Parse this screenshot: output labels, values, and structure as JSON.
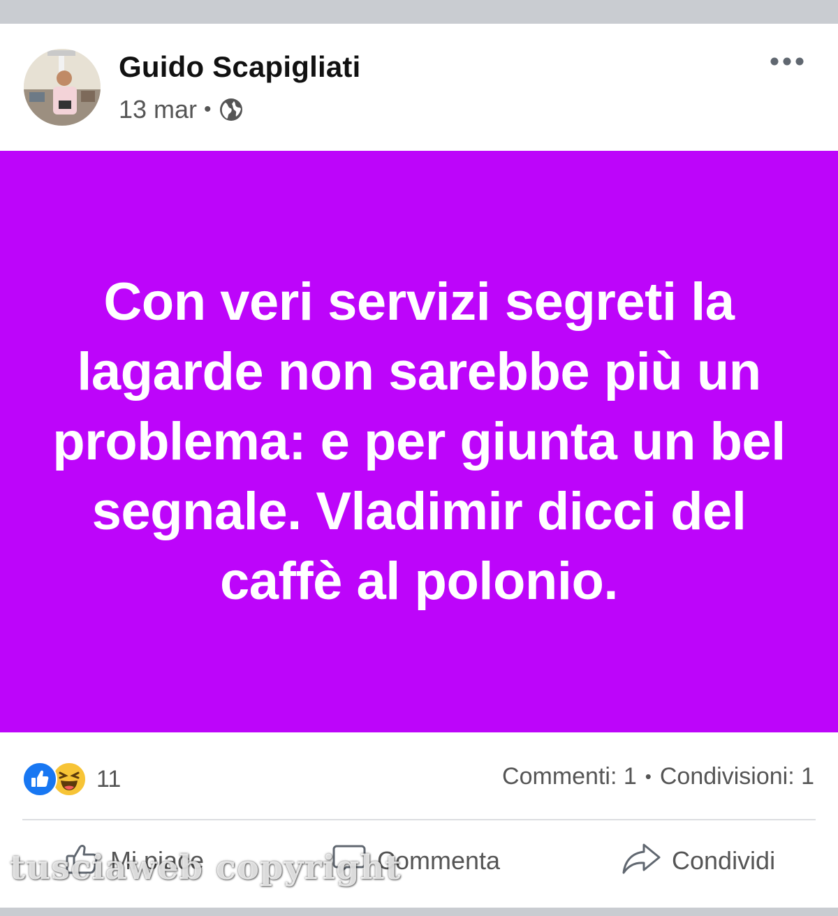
{
  "post": {
    "author": "Guido Scapigliati",
    "date": "13 mar",
    "separator": "•",
    "privacy_icon": "globe-icon",
    "more_icon": "more-horizontal-icon",
    "text": "Con veri servizi segreti la lagarde non sarebbe più un problema: e per giunta un bel segnale. Vladimir dicci del caffè al polonio.",
    "background_color": "#bd05fa"
  },
  "stats": {
    "reaction_icons": [
      "like-reaction-icon",
      "haha-reaction-icon"
    ],
    "reaction_count": "11",
    "comments": "Commenti: 1",
    "separator": "•",
    "shares": "Condivisioni: 1"
  },
  "actions": {
    "like_label": "Mi piace",
    "comment_label": "Commenta",
    "share_label": "Condividi"
  },
  "watermark": "tusciaweb copyright",
  "colors": {
    "like_blue": "#1877f2",
    "haha_yellow": "#f7c436",
    "text_gray": "#555555"
  }
}
